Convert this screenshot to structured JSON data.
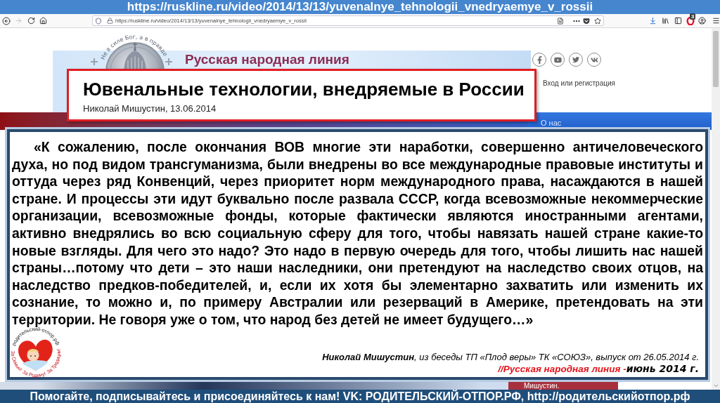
{
  "banner": {
    "url": "https://ruskline.ru/video/2014/13/13/yuvenalnye_tehnologii_vnedryaemye_v_rossii"
  },
  "browser": {
    "address": "https://ruskline.ru/video/2014/13/13/yuvenalnye_tehnologii_vnedryaemye_v_rossii",
    "extension_badge": "3"
  },
  "site": {
    "motto": "Не в силе Бог, а в правде",
    "name": "Русская народная линия",
    "login": "Вход или регистрация",
    "nav": [
      "О нас"
    ],
    "caption": "Мишустин."
  },
  "title_card": {
    "title": "Ювенальные технологии, внедряемые в России",
    "byline": "Николай Мишустин, 13.06.2014"
  },
  "quote": {
    "text": "«К сожалению, после окончания ВОВ многие эти наработки, совершенно античеловеческого духа, но под видом трансгуманизма, были внедрены во все международные правовые институты и оттуда через ряд Конвенций, через приоритет норм международного права, насаждаются в нашей стране. И процессы эти идут буквально после развала СССР, когда всевозможные некоммерческие организации, всевозможные фонды, которые фактически являются иностранными агентами, активно внедрялись во всю социальную сферу для того, чтобы навязать нашей стране какие-то новые взгляды. Для чего это надо? Это надо в первую очередь для того, чтобы лишить нас нашей страны…потому что дети – это наши наследники, они претендуют на наследство своих отцов, на наследство предков-победителей, и, если их хотя бы элементарно захватить или изменить их сознание, то можно и, по примеру Австралии или резерваций в Америке, претендовать на эти территории. Не говоря уже о том, что народ без детей не имеет будущего…»",
    "attribution": "**Николай Мишустин**, из беседы ТП «Плод веры» ТК «СОЮЗ», выпуск от 26.05.2014 г.",
    "source": "//Русская народная линия -",
    "date": "июнь 2014 г."
  },
  "badge_logo": {
    "top_text": "родительский-отпор.рф",
    "slogans": [
      "За Семью!",
      "За Родину!",
      "За Традиции!"
    ]
  },
  "footer": {
    "text": "Помогайте, подписывайтесь и присоединяйтесь к нам! VK: РОДИТЕЛЬСКИЙ-ОТПОР.РФ, http://родительскийотпор.рф"
  }
}
